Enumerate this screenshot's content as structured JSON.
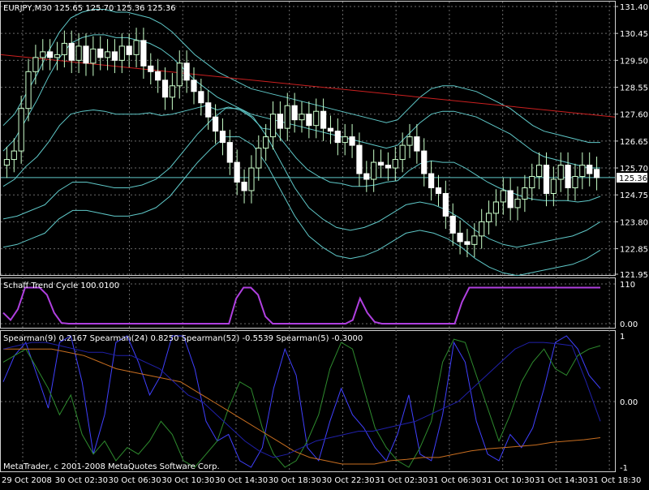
{
  "theme": {
    "background": "#000000",
    "grid": "#6a6a6a",
    "frame": "#d0d0d0",
    "text": "#ffffff",
    "bull_candle": "#ccffcc",
    "bear_candle": "#ffffff",
    "wick": "#c8ffc8",
    "bands": "#5fc8c8",
    "trend_line": "#cc2020",
    "price_line": "#5fc8c8",
    "schaff": "#b040e0",
    "spearman_colors": [
      "#4040ff",
      "#2e8b2e",
      "#c86e20",
      "#2020aa"
    ]
  },
  "header": {
    "symbol_text": "EURJPY,M30  125.65 125.70 125.36 125.36",
    "schaff_text": "Schaff Trend Cycle 100.0100",
    "spearman_text": "Spearman(9) 0.2167  Spearman(24) 0.8250  Spearman(52) -0.5539  Spearman(5) -0.3000",
    "copyright": "MetaTrader, c 2001-2008 MetaQuotes Software Corp.",
    "current_price_label": "125.36"
  },
  "chart_data": [
    {
      "type": "candlestick",
      "title": "EURJPY,M30",
      "ohlc_header": [
        125.65,
        125.7,
        125.36,
        125.36
      ],
      "ylim": [
        121.95,
        131.4
      ],
      "y_ticks": [
        "131.40",
        "130.45",
        "129.50",
        "128.55",
        "127.60",
        "126.65",
        "125.70",
        "124.75",
        "123.80",
        "122.85",
        "121.95"
      ],
      "y_tick_values": [
        131.4,
        130.45,
        129.5,
        128.55,
        127.6,
        126.65,
        125.7,
        124.75,
        123.8,
        122.85,
        121.95
      ],
      "x_ticks": [
        "29 Oct 2008",
        "30 Oct 02:30",
        "30 Oct 06:30",
        "30 Oct 10:30",
        "30 Oct 14:30",
        "30 Oct 18:30",
        "30 Oct 22:30",
        "31 Oct 02:30",
        "31 Oct 06:30",
        "31 Oct 10:30",
        "31 Oct 14:30",
        "31 Oct 18:30"
      ],
      "current_price": 125.36,
      "closes": [
        126.0,
        126.3,
        127.8,
        129.1,
        129.6,
        129.8,
        129.6,
        129.7,
        130.1,
        129.5,
        130.0,
        129.4,
        129.9,
        129.6,
        129.8,
        129.5,
        130.0,
        129.7,
        130.2,
        129.3,
        129.1,
        128.8,
        128.2,
        128.6,
        129.4,
        128.8,
        128.4,
        128.0,
        127.5,
        127.0,
        126.6,
        125.9,
        125.2,
        124.9,
        125.7,
        126.4,
        126.8,
        127.6,
        127.1,
        127.9,
        127.4,
        127.6,
        127.2,
        127.7,
        127.1,
        127.0,
        126.6,
        126.8,
        126.5,
        125.5,
        125.3,
        125.9,
        125.8,
        125.7,
        126.0,
        126.5,
        126.8,
        126.3,
        125.5,
        125.0,
        124.8,
        124.0,
        123.4,
        123.1,
        123.0,
        123.3,
        123.8,
        124.1,
        124.5,
        124.9,
        124.3,
        124.6,
        125.0,
        125.4,
        125.8,
        124.8,
        125.3,
        125.8,
        125.0,
        125.4,
        125.8,
        125.5,
        125.36
      ],
      "opens": [
        125.8,
        126.0,
        126.3,
        127.8,
        129.1,
        129.6,
        129.8,
        129.6,
        129.7,
        130.1,
        129.5,
        130.0,
        129.4,
        129.9,
        129.6,
        129.8,
        129.5,
        130.0,
        129.7,
        130.2,
        129.3,
        129.1,
        128.8,
        128.2,
        128.6,
        129.4,
        128.8,
        128.4,
        128.0,
        127.5,
        127.0,
        126.6,
        125.9,
        125.2,
        124.9,
        125.7,
        126.4,
        126.8,
        127.6,
        127.1,
        127.9,
        127.4,
        127.6,
        127.2,
        127.7,
        127.1,
        127.0,
        126.6,
        126.8,
        126.5,
        125.5,
        125.3,
        125.9,
        125.8,
        125.7,
        126.0,
        126.5,
        126.8,
        126.3,
        125.5,
        125.0,
        124.8,
        124.0,
        123.4,
        123.1,
        123.0,
        123.3,
        123.8,
        124.1,
        124.5,
        124.9,
        124.3,
        124.6,
        125.0,
        125.4,
        125.8,
        124.8,
        125.3,
        125.8,
        125.0,
        125.4,
        125.8,
        125.65
      ],
      "upper_band_outer": [
        127.2,
        127.6,
        128.3,
        129.0,
        129.8,
        130.5,
        131.0,
        131.2,
        131.3,
        131.3,
        131.2,
        131.2,
        131.1,
        131.0,
        130.8,
        130.5,
        130.1,
        129.7,
        129.4,
        129.1,
        128.9,
        128.7,
        128.5,
        128.4,
        128.3,
        128.2,
        128.1,
        128.0,
        127.9,
        127.8,
        127.7,
        127.6,
        127.5,
        127.4,
        127.3,
        127.4,
        127.8,
        128.2,
        128.5,
        128.6,
        128.6,
        128.5,
        128.4,
        128.2,
        128.0,
        127.8,
        127.5,
        127.2,
        127.0,
        126.9,
        126.8,
        126.7,
        126.6,
        126.6
      ],
      "lower_band_outer": [
        122.9,
        123.0,
        123.2,
        123.4,
        123.9,
        124.2,
        124.2,
        124.1,
        124.0,
        124.0,
        124.1,
        124.3,
        124.7,
        125.3,
        125.9,
        126.4,
        126.8,
        126.8,
        126.5,
        125.8,
        124.9,
        124.0,
        123.3,
        122.9,
        122.6,
        122.5,
        122.6,
        122.8,
        123.1,
        123.4,
        123.5,
        123.4,
        123.2,
        122.9,
        122.5,
        122.2,
        122.0,
        121.9,
        122.0,
        122.1,
        122.2,
        122.3,
        122.5,
        122.8
      ]
    },
    {
      "type": "line",
      "title": "Schaff Trend Cycle 100.0100",
      "ylim": [
        0,
        110
      ],
      "y_ticks": [
        "110",
        "0.00"
      ],
      "values": [
        30,
        10,
        40,
        100,
        100,
        100,
        80,
        30,
        2,
        0,
        0,
        0,
        0,
        0,
        0,
        0,
        0,
        0,
        0,
        0,
        0,
        0,
        0,
        0,
        0,
        0,
        0,
        0,
        0,
        0,
        0,
        0,
        70,
        100,
        100,
        80,
        20,
        0,
        0,
        0,
        0,
        0,
        0,
        0,
        0,
        0,
        0,
        0,
        10,
        70,
        30,
        5,
        0,
        0,
        0,
        0,
        0,
        0,
        0,
        0,
        0,
        0,
        0,
        60,
        100,
        100,
        100,
        100,
        100,
        100,
        100,
        100,
        100,
        100,
        100,
        100,
        100,
        100,
        100,
        100,
        100,
        100,
        100
      ]
    },
    {
      "type": "line",
      "title": "Spearman",
      "ylim": [
        -1,
        1
      ],
      "y_ticks": [
        "1",
        "0.00",
        "-1"
      ],
      "series": [
        {
          "name": "Spearman(9)",
          "values": [
            0.3,
            0.7,
            0.9,
            0.4,
            -0.1,
            0.9,
            1,
            0.3,
            -0.8,
            -0.2,
            0.9,
            1,
            0.6,
            0.1,
            0.4,
            1,
            1,
            0.5,
            -0.3,
            -0.6,
            -0.5,
            -0.9,
            -1,
            -0.7,
            0.2,
            0.8,
            0.4,
            -0.7,
            -0.9,
            -0.3,
            0.2,
            -0.2,
            -0.4,
            -0.7,
            -0.9,
            -0.5,
            0.1,
            -0.8,
            -0.9,
            -0.2,
            0.9,
            0.6,
            -0.3,
            -0.8,
            -0.9,
            -0.5,
            -0.7,
            -0.4,
            0.2,
            0.9,
            1,
            0.8,
            0.4,
            0.2
          ]
        },
        {
          "name": "Spearman(24)",
          "values": [
            0.6,
            0.7,
            0.8,
            0.5,
            0.2,
            -0.2,
            0.1,
            -0.5,
            -0.8,
            -0.6,
            -0.9,
            -0.7,
            -0.8,
            -0.6,
            -0.3,
            -0.5,
            -0.9,
            -1,
            -0.8,
            -0.6,
            -0.1,
            0.3,
            0.2,
            -0.4,
            -0.8,
            -1,
            -0.9,
            -0.6,
            -0.2,
            0.5,
            0.9,
            0.8,
            0.2,
            -0.4,
            -0.7,
            -0.9,
            -1,
            -0.7,
            -0.3,
            0.6,
            0.95,
            0.9,
            0.4,
            -0.1,
            -0.6,
            -0.2,
            0.3,
            0.6,
            0.8,
            0.5,
            0.4,
            0.7,
            0.8,
            0.85
          ]
        },
        {
          "name": "Spearman(52)",
          "values": [
            0.8,
            0.8,
            0.8,
            0.8,
            0.75,
            0.7,
            0.6,
            0.5,
            0.45,
            0.4,
            0.35,
            0.3,
            0.15,
            0.0,
            -0.15,
            -0.3,
            -0.45,
            -0.6,
            -0.75,
            -0.85,
            -0.9,
            -0.95,
            -0.95,
            -0.95,
            -0.9,
            -0.88,
            -0.85,
            -0.85,
            -0.8,
            -0.75,
            -0.72,
            -0.7,
            -0.68,
            -0.66,
            -0.62,
            -0.6,
            -0.58,
            -0.55
          ]
        },
        {
          "name": "Spearman(5)",
          "values": [
            0.8,
            0.85,
            0.9,
            0.9,
            0.85,
            0.8,
            0.75,
            0.75,
            0.7,
            0.7,
            0.6,
            0.5,
            0.3,
            0.1,
            0.0,
            -0.2,
            -0.4,
            -0.6,
            -0.75,
            -0.85,
            -0.8,
            -0.7,
            -0.6,
            -0.55,
            -0.5,
            -0.45,
            -0.45,
            -0.4,
            -0.35,
            -0.3,
            -0.2,
            -0.1,
            0.0,
            0.2,
            0.4,
            0.6,
            0.8,
            0.9,
            0.9,
            0.88,
            0.85,
            0.3,
            -0.3
          ]
        }
      ]
    }
  ]
}
